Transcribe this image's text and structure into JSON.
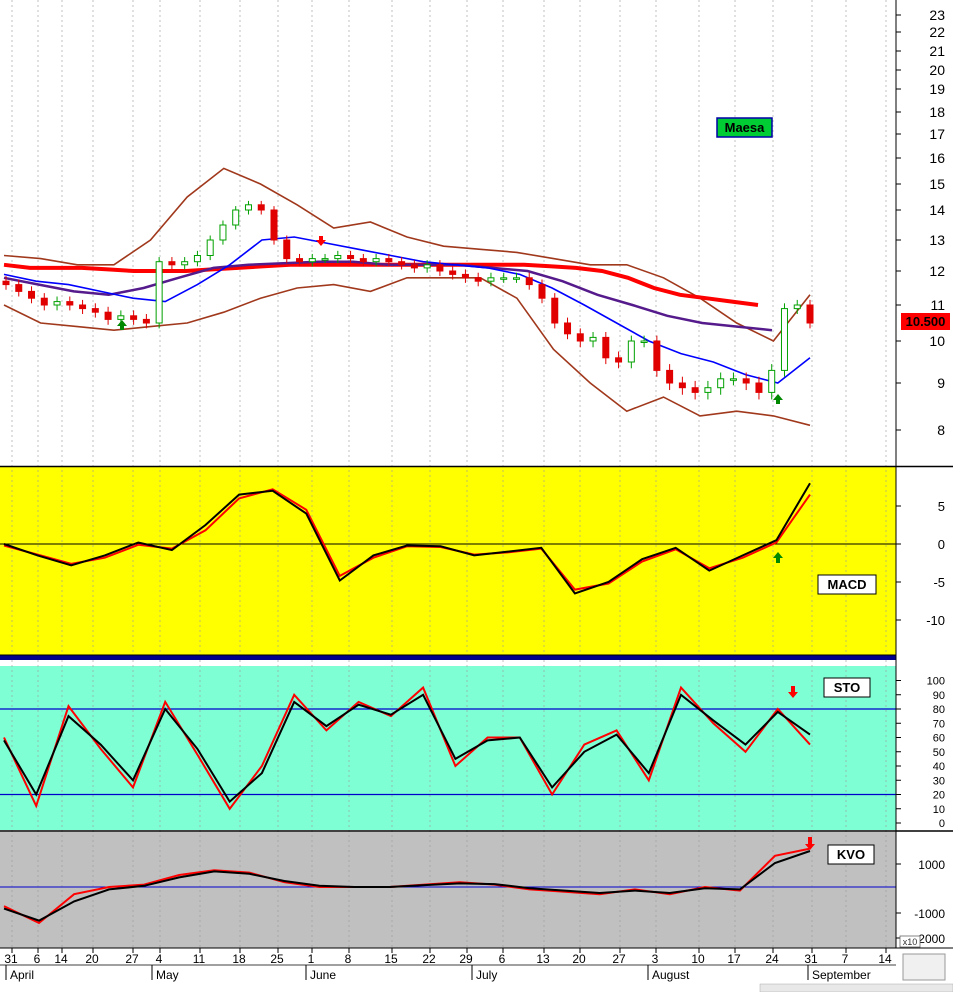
{
  "chart_data": {
    "type": "candlestick",
    "ticker": "Maesa",
    "last_price": "10.500",
    "colors": {
      "price_bg": "#ffffff",
      "macd_bg": "#ffff00",
      "sto_bg": "#7fffd4",
      "kvo_bg": "#c0c0c0",
      "up_candle": "#00a000",
      "down_candle": "#e00000",
      "ma_red": "#ff0000",
      "ma_purple": "#551a8b",
      "ma_blue": "#0000ff",
      "bollinger": "#a0381c",
      "signal_red": "#ff0000",
      "signal_black": "#000000",
      "price_tag": "#ff0000"
    },
    "x_axis": {
      "days": [
        "31",
        "6",
        "14",
        "20",
        "27",
        "4",
        "11",
        "18",
        "25",
        "1",
        "8",
        "15",
        "22",
        "29",
        "6",
        "13",
        "20",
        "27",
        "3",
        "10",
        "17",
        "24",
        "31",
        "7",
        "14"
      ],
      "months": [
        "April",
        "May",
        "June",
        "July",
        "August",
        "September"
      ],
      "scale_note": "x10"
    },
    "price_panel": {
      "y_ticks": [
        "23",
        "22",
        "21",
        "20",
        "19",
        "18",
        "17",
        "16",
        "15",
        "14",
        "13",
        "12",
        "11",
        "10",
        "9",
        "8"
      ],
      "close": [
        11.6,
        11.4,
        11.2,
        11.0,
        11.1,
        11.0,
        10.9,
        10.8,
        10.6,
        10.7,
        10.6,
        10.5,
        12.3,
        12.2,
        12.3,
        12.5,
        13.0,
        13.5,
        14.0,
        14.2,
        14.0,
        13.0,
        12.4,
        12.3,
        12.4,
        12.4,
        12.5,
        12.4,
        12.3,
        12.4,
        12.3,
        12.2,
        12.1,
        12.2,
        12.0,
        11.9,
        11.8,
        11.7,
        11.8,
        11.8,
        11.8,
        11.6,
        11.2,
        10.5,
        10.2,
        10.0,
        10.1,
        9.6,
        9.5,
        10.0,
        10.0,
        9.3,
        9.0,
        8.9,
        8.8,
        8.9,
        9.1,
        9.1,
        9.0,
        8.8,
        9.3,
        10.9,
        11.0,
        10.5
      ],
      "ma_red": [
        12.2,
        12.1,
        12.1,
        12.1,
        12.05,
        12.0,
        12.0,
        12.0,
        12.05,
        12.1,
        12.15,
        12.2,
        12.2,
        12.2,
        12.2,
        12.2,
        12.2,
        12.2,
        12.2,
        12.2,
        12.2,
        12.15,
        12.1,
        12.0,
        11.8,
        11.5,
        11.3,
        11.2,
        11.1,
        11.0
      ],
      "ma_purple": [
        11.8,
        11.6,
        11.4,
        11.3,
        11.5,
        11.8,
        12.1,
        12.2,
        12.25,
        12.3,
        12.3,
        12.2,
        12.2,
        12.2,
        12.1,
        12.0,
        11.7,
        11.3,
        11.0,
        10.7,
        10.5,
        10.4,
        10.3
      ],
      "ma_blue": [
        11.9,
        11.7,
        11.6,
        11.4,
        11.2,
        11.1,
        11.6,
        12.2,
        13.0,
        13.1,
        12.9,
        12.7,
        12.5,
        12.3,
        12.2,
        12.1,
        11.9,
        11.5,
        11.0,
        10.5,
        10.0,
        9.7,
        9.5,
        9.2,
        9.0,
        9.6
      ],
      "bollinger_upper": [
        12.5,
        12.4,
        12.2,
        12.2,
        13.0,
        14.5,
        15.6,
        15.0,
        14.2,
        13.4,
        13.6,
        13.1,
        12.8,
        12.7,
        12.6,
        12.4,
        12.2,
        12.2,
        11.8,
        11.2,
        10.5,
        10.0,
        11.3
      ],
      "bollinger_lower": [
        11.0,
        10.5,
        10.4,
        10.3,
        10.4,
        10.5,
        10.8,
        11.2,
        11.5,
        11.6,
        11.4,
        11.8,
        11.8,
        11.8,
        11.2,
        9.8,
        9.0,
        8.4,
        8.7,
        8.3,
        8.4,
        8.3,
        8.1
      ],
      "buy_arrows": 3,
      "sell_arrows": 1
    },
    "macd_panel": {
      "label": "MACD",
      "y_ticks": [
        "5",
        "0",
        "-5",
        "-10"
      ],
      "macd": [
        0,
        -1.5,
        -2.8,
        -1.5,
        0.2,
        -0.8,
        2.5,
        6.5,
        7.0,
        4.0,
        -4.8,
        -1.5,
        -0.2,
        -0.3,
        -1.5,
        -1.0,
        -0.5,
        -6.5,
        -5.0,
        -2.0,
        -0.5,
        -3.5,
        -1.5,
        0.5,
        8.0
      ],
      "signal": [
        -0.2,
        -1.4,
        -2.6,
        -1.8,
        -0.1,
        -0.6,
        1.8,
        6.0,
        7.2,
        4.5,
        -4.2,
        -1.8,
        -0.3,
        -0.4,
        -1.4,
        -1.1,
        -0.6,
        -6.0,
        -5.2,
        -2.3,
        -0.7,
        -3.2,
        -1.8,
        0.2,
        6.5
      ]
    },
    "sto_panel": {
      "label": "STO",
      "y_ticks": [
        "100",
        "90",
        "80",
        "70",
        "60",
        "50",
        "40",
        "30",
        "20",
        "10",
        "0"
      ],
      "overbought": 80,
      "oversold": 20,
      "k": [
        60,
        12,
        82,
        52,
        25,
        85,
        48,
        10,
        40,
        90,
        65,
        85,
        75,
        95,
        40,
        60,
        60,
        20,
        55,
        65,
        30,
        95,
        70,
        50,
        80,
        55
      ],
      "d": [
        58,
        20,
        75,
        55,
        30,
        80,
        52,
        15,
        35,
        85,
        68,
        83,
        76,
        90,
        45,
        58,
        60,
        25,
        50,
        62,
        35,
        90,
        72,
        55,
        78,
        62
      ]
    },
    "kvo_panel": {
      "label": "KVO",
      "y_ticks": [
        "1000",
        "-1000",
        "2000"
      ],
      "kvo": [
        -800,
        -1500,
        -300,
        0,
        100,
        500,
        700,
        600,
        200,
        0,
        0,
        0,
        100,
        200,
        100,
        -100,
        -200,
        -300,
        -100,
        -300,
        0,
        -150,
        1300,
        1600
      ],
      "signal": [
        -900,
        -1400,
        -600,
        -100,
        50,
        400,
        650,
        550,
        250,
        50,
        0,
        0,
        80,
        150,
        120,
        -50,
        -150,
        -250,
        -150,
        -250,
        -50,
        -100,
        1000,
        1500
      ]
    }
  }
}
